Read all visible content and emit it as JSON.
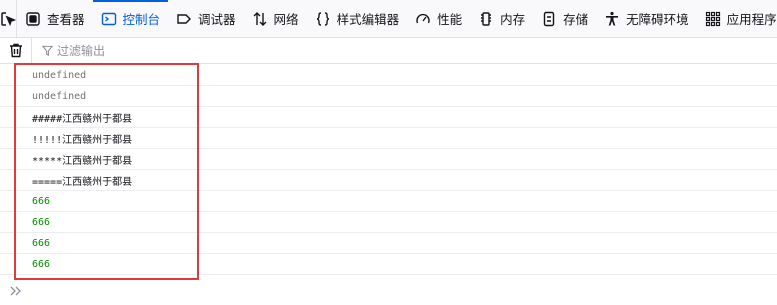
{
  "toolbar": {
    "tabs": [
      {
        "label": "查看器",
        "icon": "inspector-icon"
      },
      {
        "label": "控制台",
        "icon": "console-icon",
        "selected": true
      },
      {
        "label": "调试器",
        "icon": "debugger-icon"
      },
      {
        "label": "网络",
        "icon": "network-icon"
      },
      {
        "label": "样式编辑器",
        "icon": "style-editor-icon"
      },
      {
        "label": "性能",
        "icon": "performance-icon"
      },
      {
        "label": "内存",
        "icon": "memory-icon"
      },
      {
        "label": "存储",
        "icon": "storage-icon"
      },
      {
        "label": "无障碍环境",
        "icon": "accessibility-icon"
      },
      {
        "label": "应用程序",
        "icon": "application-icon"
      }
    ]
  },
  "filter": {
    "placeholder": "过滤输出"
  },
  "console": {
    "messages": [
      {
        "text": "undefined",
        "type": "undefined"
      },
      {
        "text": "undefined",
        "type": "undefined"
      },
      {
        "text": "#####江西赣州于都县",
        "type": "log"
      },
      {
        "text": "!!!!!江西赣州于都县",
        "type": "log"
      },
      {
        "text": "*****江西赣州于都县",
        "type": "log"
      },
      {
        "text": "=====江西赣州于都县",
        "type": "log"
      },
      {
        "text": "666",
        "type": "number"
      },
      {
        "text": "666",
        "type": "number"
      },
      {
        "text": "666",
        "type": "number"
      },
      {
        "text": "666",
        "type": "number"
      }
    ]
  },
  "colors": {
    "accent": "#0060df",
    "highlight_box": "#e0393e",
    "number_text": "#058b00"
  }
}
